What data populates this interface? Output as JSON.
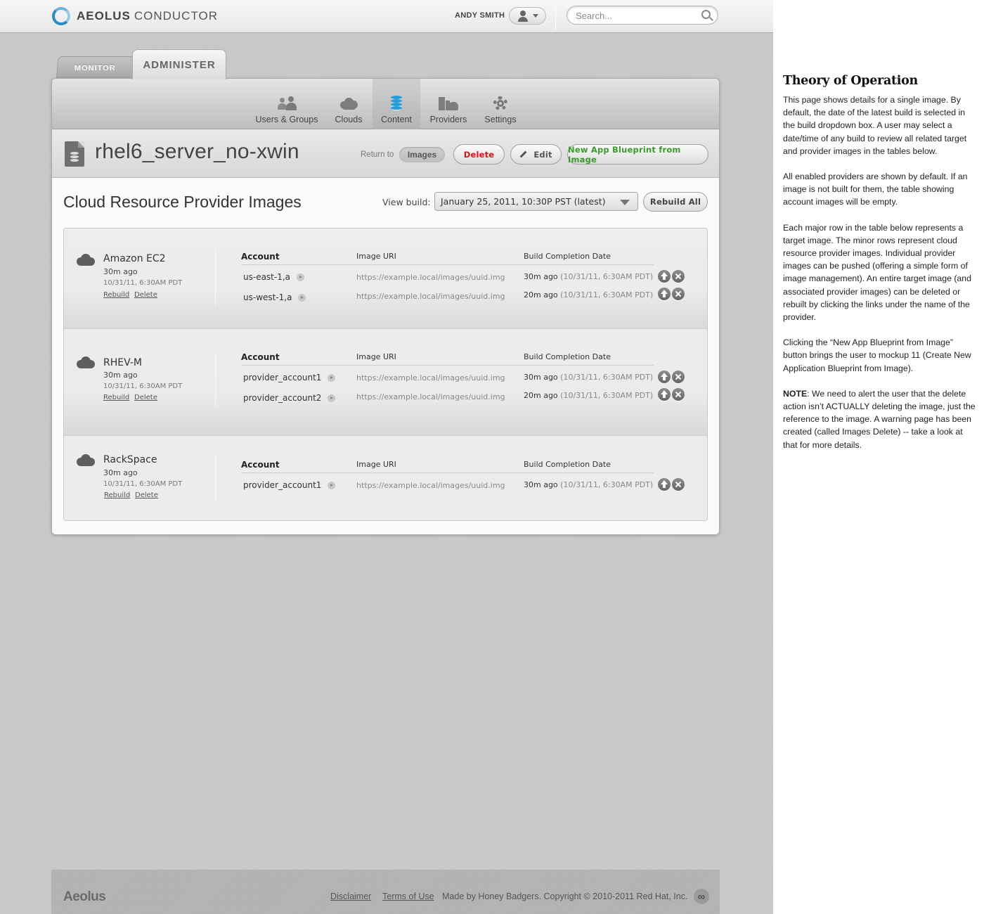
{
  "header": {
    "logo_bold": "AEOLUS",
    "logo_light": "CONDUCTOR",
    "user_name": "ANDY SMITH",
    "search_placeholder": "Search..."
  },
  "tabs": {
    "monitor": "MONITOR",
    "administer": "ADMINISTER"
  },
  "subnav": {
    "items": [
      {
        "label": "Users & Groups",
        "icon": "users-icon"
      },
      {
        "label": "Clouds",
        "icon": "cloud-icon"
      },
      {
        "label": "Content",
        "icon": "database-icon",
        "active": true
      },
      {
        "label": "Providers",
        "icon": "providers-icon"
      },
      {
        "label": "Settings",
        "icon": "gear-icon"
      }
    ]
  },
  "title_bar": {
    "title": "rhel6_server_no-xwin",
    "return_to": "Return to",
    "images_link": "Images",
    "delete": "Delete",
    "edit": "Edit",
    "new_blueprint": "New App Blueprint from Image"
  },
  "section": {
    "title": "Cloud Resource Provider Images",
    "view_build_label": "View build:",
    "view_build_value": "January 25, 2011, 10:30P PST (latest)",
    "rebuild_all": "Rebuild All"
  },
  "columns": {
    "account": "Account",
    "image_uri": "Image URI",
    "build_date": "Build Completion Date"
  },
  "providers": [
    {
      "name": "Amazon EC2",
      "ago": "30m ago",
      "date": "10/31/11, 6:30AM PDT",
      "rebuild": "Rebuild",
      "delete": "Delete",
      "accounts": [
        {
          "account": "us-east-1,a",
          "uri": "https://example.local/images/uuid.img",
          "ago": "30m ago",
          "date": "(10/31/11, 6:30AM PDT)"
        },
        {
          "account": "us-west-1,a",
          "uri": "https://example.local/images/uuid.img",
          "ago": "20m ago",
          "date": "(10/31/11, 6:30AM PDT)"
        }
      ]
    },
    {
      "name": "RHEV-M",
      "ago": "30m ago",
      "date": "10/31/11, 6:30AM PDT",
      "rebuild": "Rebuild",
      "delete": "Delete",
      "accounts": [
        {
          "account": "provider_account1",
          "uri": "https://example.local/images/uuid.img",
          "ago": "30m ago",
          "date": "(10/31/11, 6:30AM PDT)"
        },
        {
          "account": "provider_account2",
          "uri": "https://example.local/images/uuid.img",
          "ago": "20m ago",
          "date": "(10/31/11, 6:30AM PDT)"
        }
      ]
    },
    {
      "name": "RackSpace",
      "ago": "30m ago",
      "date": "10/31/11, 6:30AM PDT",
      "rebuild": "Rebuild",
      "delete": "Delete",
      "accounts": [
        {
          "account": "provider_account1",
          "uri": "https://example.local/images/uuid.img",
          "ago": "30m ago",
          "date": "(10/31/11, 6:30AM PDT)"
        }
      ]
    }
  ],
  "footer": {
    "logo": "Aeolus",
    "disclaimer": "Disclaimer",
    "terms": "Terms of Use",
    "copyright": "Made by Honey Badgers. Copyright © 2010-2011 Red Hat, Inc.",
    "infinity": "∞"
  },
  "notes": {
    "heading": "Theory of Operation",
    "p1": "This page shows details for a single image. By default, the date of the latest build is selected in the build dropdown box. A user may select a date/time of any build to review all related target and provider images in the tables below.",
    "p2": "All enabled providers are shown by default. If an image is not built for them, the table showing account images will be empty.",
    "p3": "Each major row in the table below represents a target image. The minor rows represent cloud resource provider images. Individual provider images can be pushed (offering a simple form of image management). An entire target image (and associated provider images) can be deleted or rebuilt by clicking the links under the name of the provider.",
    "p4": "Clicking the “New App Blueprint from Image” button brings the user to mockup 11 (Create New Application Blueprint from Image).",
    "p5_bold": "NOTE",
    "p5": ": We need to alert the user that the delete action isn’t ACTUALLY deleting the image, just the reference to the image. A warning page has been created (called Images Delete) -- take a look at that for more details."
  },
  "colors": {
    "accent_blue": "#2b9bd8",
    "delete_red": "#c61c1c",
    "blueprint_green": "#3a9a2b"
  }
}
